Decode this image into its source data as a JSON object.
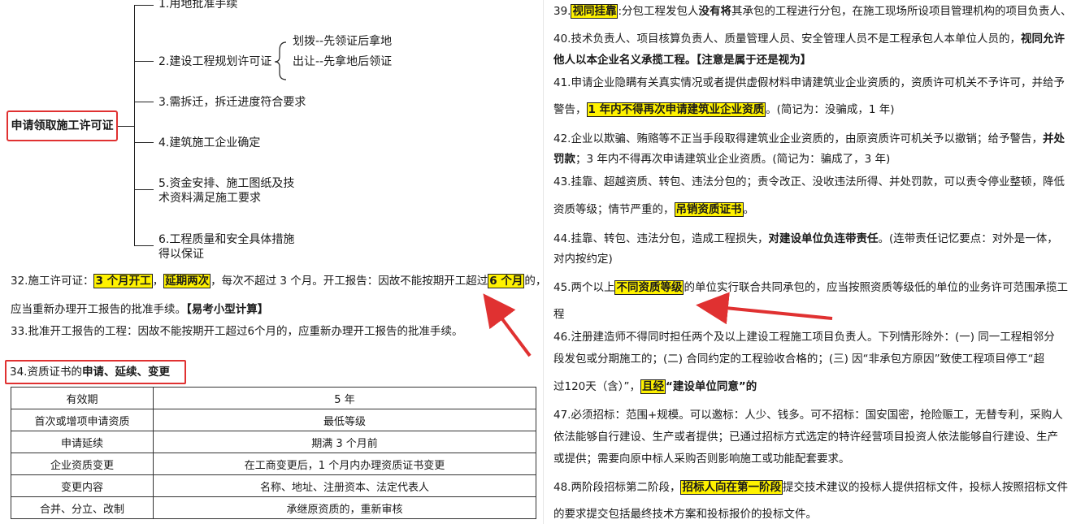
{
  "mindmap": {
    "root": "申请领取施工许可证",
    "items": [
      "1.用地批准手续",
      "2.建设工程规划许可证",
      "3.需拆迁，拆迁进度符合要求",
      "4.建筑施工企业确定",
      "5.资金安排、施工图纸及技",
      "术资料满足施工要求",
      "6.工程质量和安全具体措施",
      "得以保证"
    ],
    "sub": [
      "划拨--先领证后拿地",
      "出让--先拿地后领证"
    ]
  },
  "left": {
    "p32": {
      "a": "32.施工许可证：",
      "h1": "3 个月开工",
      "b": "，",
      "h2": "延期两次",
      "c": "，每次不超过 3 个月。开工报告：因故不能按期开工超过",
      "h3": "6 个月",
      "d": "的，",
      "line2": "应当重新办理开工报告的批准手续。",
      "tag": "【易考小型计算】"
    },
    "p33": "33.批准开工报告的工程：因故不能按期开工超过6个月的，应重新办理开工报告的批准手续。",
    "p34": {
      "a": "34.资质证书的",
      "b": "申请、延续、变更"
    },
    "table": [
      [
        "有效期",
        "5 年"
      ],
      [
        "首次或增项申请资质",
        "最低等级"
      ],
      [
        "申请延续",
        "期满 3 个月前"
      ],
      [
        "企业资质变更",
        "在工商变更后，1 个月内办理资质证书变更"
      ],
      [
        "变更内容",
        "名称、地址、注册资本、法定代表人"
      ],
      [
        "合并、分立、改制",
        "承继原资质的，重新审核"
      ]
    ]
  },
  "right": {
    "p39": {
      "num": "39.",
      "h": "视同挂靠",
      "a": ":分包工程发包人",
      "b": "没有将",
      "c": "其承包的工程进行分包，在施工现场所设项目管理机构的项目负责人、"
    },
    "p40": {
      "a": "40.技术负责人、项目核算负责人、质量管理人员、安全管理人员不是工程承包人本单位人员的，",
      "b": "视同允许",
      "line2": "他人以本企业名义承揽工程。【注意是属于还是视为】"
    },
    "p41": {
      "a": "41.申请企业隐瞒有关真实情况或者提供虚假材料申请建筑业企业资质的，资质许可机关不予许可，并给予",
      "b": "警告，",
      "h": "1 年内不得再次申请建筑业企业资质",
      "c": "。(简记为：没骗成，1 年)"
    },
    "p42": {
      "a": "42.企业以欺骗、贿赂等不正当手段取得建筑业企业资质的，由原资质许可机关予以撤销；给予警告，",
      "b": "并处",
      "c": "罚款",
      "d": "；3 年内不得再次申请建筑业企业资质。(简记为：骗成了，3 年)"
    },
    "p43": {
      "a": "43.挂靠、超越资质、转包、违法分包的；责令改正、没收违法所得、并处罚款，可以责令停业整顿，降低",
      "b": "资质等级；情节严重的，",
      "h": "吊销资质证书",
      "c": "。"
    },
    "p44": {
      "a": "44.挂靠、转包、违法分包，造成工程损失，",
      "b": "对建设单位负连带责任",
      "c": "。(连带责任记忆要点：对外是一体，",
      "d": "对内按约定)"
    },
    "p45": {
      "a": "45.两个以上",
      "h": "不同资质等级",
      "b": "的单位实行联合共同承包的，应当按照资质等级低的单位的业务许可范围承揽工",
      "c": "程"
    },
    "p46": {
      "a": "46.注册建造师不得同时担任两个及以上建设工程施工项目负责人。下列情形除外：(一) 同一工程相邻分",
      "b": "段发包或分期施工的；(二) 合同约定的工程验收合格的；(三) 因“非承包方原因”致使工程项目停工“超",
      "c": "过120天（含）”，",
      "h": "且经",
      "d": "“建设单位同意”的"
    },
    "p47": {
      "a": "47.必须招标：范围+规模。可以邀标：人少、钱多。可不招标：国安国密，抢险赈工，无替专利，采购人",
      "b": "依法能够自行建设、生产或者提供；已通过招标方式选定的特许经营项目投资人依法能够自行建设、生产",
      "c": "或提供；需要向原中标人采购否则影响施工或功能配套要求。"
    },
    "p48": {
      "a": "48.两阶段招标第二阶段，",
      "h": "招标人向在第一阶段",
      "b": "提交技术建议的投标人提供招标文件，投标人按照招标文件",
      "c": "的要求提交包括最终技术方案和投标报价的投标文件。"
    }
  },
  "colors": {
    "highlight": "#fff200",
    "annotation": "#e03131"
  }
}
